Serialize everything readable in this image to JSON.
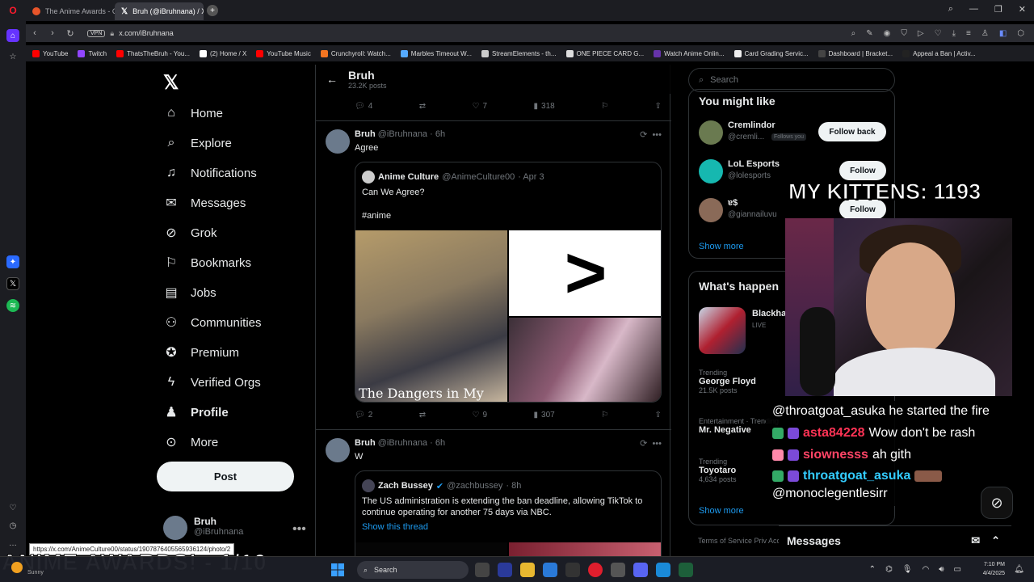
{
  "browser": {
    "tabs": [
      {
        "title": "The Anime Awards - Crun",
        "active": false,
        "color": "#e8552a"
      },
      {
        "title": "Bruh (@iBruhnana) / X",
        "active": true,
        "color": "#ffffff"
      }
    ],
    "new_tab": "+",
    "url": "x.com/iBruhnana",
    "vpn": "VPN",
    "bookmarks": [
      {
        "label": "YouTube",
        "color": "#ff0000"
      },
      {
        "label": "Twitch",
        "color": "#9146ff"
      },
      {
        "label": "ThatsTheBruh - You...",
        "color": "#ff0000"
      },
      {
        "label": "(2) Home / X",
        "color": "#ffffff"
      },
      {
        "label": "YouTube Music",
        "color": "#ff0000"
      },
      {
        "label": "Crunchyroll: Watch...",
        "color": "#f47521"
      },
      {
        "label": "Marbles Timeout W...",
        "color": "#55aaff"
      },
      {
        "label": "StreamElements - th...",
        "color": "#cccccc"
      },
      {
        "label": "ONE PIECE CARD G...",
        "color": "#dddddd"
      },
      {
        "label": "Watch Anime Onlin...",
        "color": "#6633aa"
      },
      {
        "label": "Card Grading Servic...",
        "color": "#eeeeee"
      },
      {
        "label": "Dashboard | Bracket...",
        "color": "#444444"
      },
      {
        "label": "Appeal a Ban | Activ...",
        "color": "#222222"
      }
    ]
  },
  "nav": {
    "items": [
      {
        "label": "Home",
        "icon": "home-icon"
      },
      {
        "label": "Explore",
        "icon": "search-icon"
      },
      {
        "label": "Notifications",
        "icon": "bell-icon"
      },
      {
        "label": "Messages",
        "icon": "mail-icon"
      },
      {
        "label": "Grok",
        "icon": "grok-icon"
      },
      {
        "label": "Bookmarks",
        "icon": "bookmark-icon"
      },
      {
        "label": "Jobs",
        "icon": "briefcase-icon"
      },
      {
        "label": "Communities",
        "icon": "people-icon"
      },
      {
        "label": "Premium",
        "icon": "verified-icon"
      },
      {
        "label": "Verified Orgs",
        "icon": "lightning-icon"
      },
      {
        "label": "Profile",
        "icon": "person-icon"
      },
      {
        "label": "More",
        "icon": "more-icon"
      }
    ],
    "post_label": "Post",
    "me_name": "Bruh",
    "me_handle": "@iBruhnana"
  },
  "feed": {
    "title": "Bruh",
    "subtitle": "23.2K posts",
    "top_actions": {
      "replies": "4",
      "likes": "7",
      "views": "318"
    },
    "tweet1": {
      "name": "Bruh",
      "handle": "@iBruhnana",
      "time": "· 6h",
      "text": "Agree",
      "quote": {
        "name": "Anime Culture",
        "handle": "@AnimeCulture00",
        "time": "· Apr 3",
        "line1": "Can We Agree?",
        "line2": "#anime",
        "image_caption": "The Dangers in My",
        "image_symbol": ">"
      },
      "actions": {
        "replies": "2",
        "likes": "9",
        "views": "307"
      }
    },
    "tweet2": {
      "name": "Bruh",
      "handle": "@iBruhnana",
      "time": "· 6h",
      "text": "W",
      "quote": {
        "name": "Zach Bussey",
        "handle": "@zachbussey",
        "time": "· 8h",
        "text": "The US administration is extending the ban deadline, allowing TikTok to continue operating for another 75 days via NBC.",
        "thread_link": "Show this thread"
      }
    }
  },
  "right": {
    "search_placeholder": "Search",
    "wtf_title": "You might like",
    "who": [
      {
        "name": "Cremlindor",
        "handle": "@cremli...",
        "badge": "Follows you",
        "button": "Follow back",
        "color": "#6a7a50"
      },
      {
        "name": "LoL Esports",
        "handle": "@lolesports",
        "badge": "",
        "button": "Follow",
        "color": "#16b8b0"
      },
      {
        "name": "ɐ$",
        "handle": "@giannailuvu",
        "badge": "",
        "button": "Follow",
        "color": "#8a6a58"
      }
    ],
    "show_more": "Show more",
    "happening_title": "What's happen",
    "live_event": {
      "name": "Blackha",
      "status": "LIVE"
    },
    "trends": [
      {
        "category": "Trending",
        "name": "George Floyd",
        "posts": "21.5K posts"
      },
      {
        "category": "Entertainment · Trending",
        "name": "Mr. Negative",
        "posts": ""
      },
      {
        "category": "Trending",
        "name": "Toyotaro",
        "posts": "4,634 posts"
      }
    ],
    "show_more2": "Show more",
    "footer": "Terms of Service  Priv  Accessibility  Ads info"
  },
  "overlay": {
    "kittens": "MY KITTENS: 1193",
    "awards": "ANIME AWARDS! - 1/10",
    "chat": [
      {
        "user": "",
        "msg": "@throatgoat_asuka he started the fire",
        "color": "#ffffff"
      },
      {
        "user": "asta84228",
        "msg": "Wow don't be rash",
        "color": "#ff3355"
      },
      {
        "user": "siownesss",
        "msg": "ah gith",
        "color": "#ff4466"
      },
      {
        "user": "throatgoat_asuka",
        "msg": "",
        "color": "#33ccff"
      },
      {
        "user": "",
        "msg": "@monoclegentlesirr",
        "color": "#ffffff"
      }
    ],
    "messages_label": "Messages",
    "url_tooltip": "https://x.com/AnimeCulture00/status/1907876405565936124/photo/2"
  },
  "taskbar": {
    "search": "Search",
    "weather": "Sunny",
    "time": "7:10 PM",
    "date": "4/4/2025"
  }
}
